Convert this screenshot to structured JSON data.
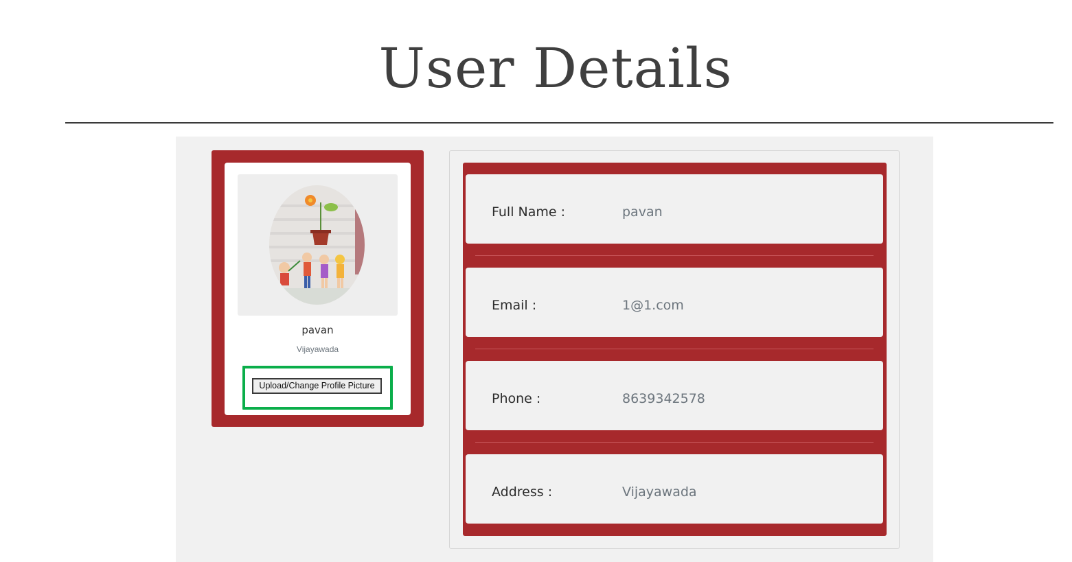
{
  "page": {
    "title": "User Details"
  },
  "profile": {
    "name": "pavan",
    "city": "Vijayawada",
    "upload_button_label": "Upload/Change Profile Picture"
  },
  "details": {
    "rows": [
      {
        "label": "Full Name :",
        "value": "pavan"
      },
      {
        "label": "Email :",
        "value": "1@1.com"
      },
      {
        "label": "Phone :",
        "value": "8639342578"
      },
      {
        "label": "Address :",
        "value": "Vijayawada"
      }
    ]
  },
  "colors": {
    "frame": "#a7292c",
    "highlight": "#0aae4a",
    "panel_bg": "#f1f1f1"
  }
}
